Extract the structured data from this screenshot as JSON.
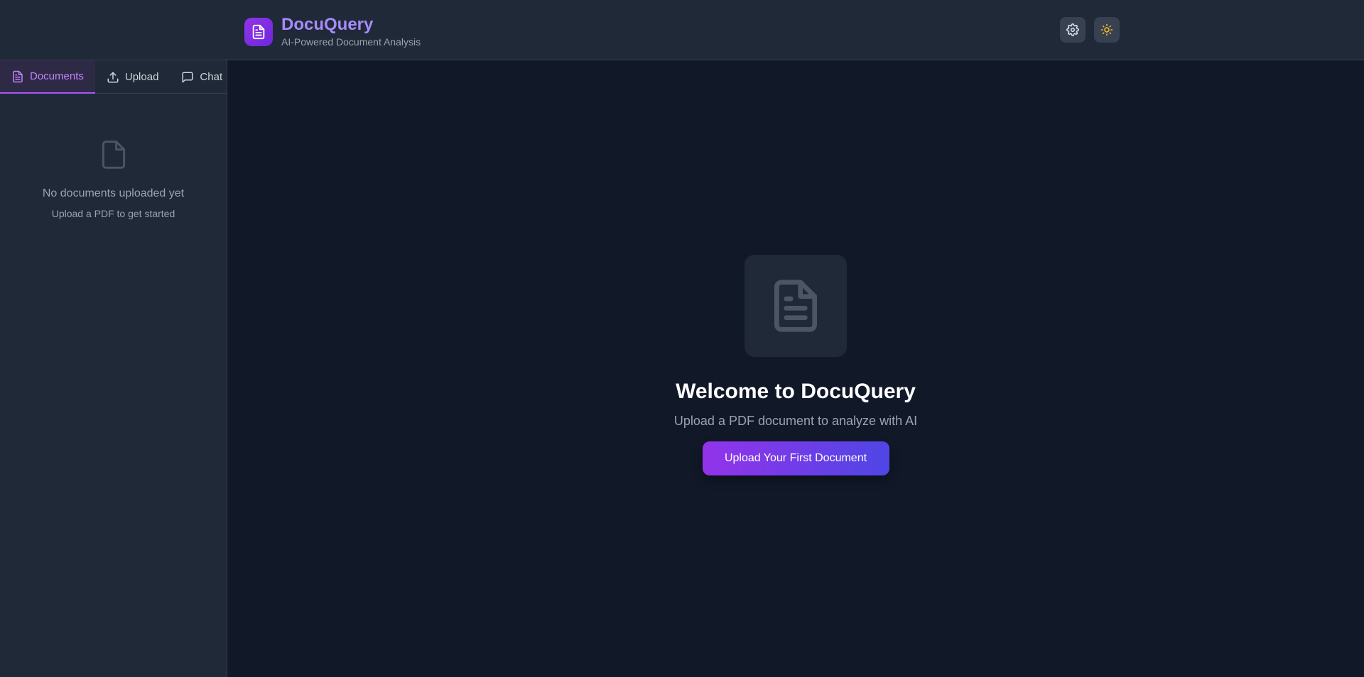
{
  "header": {
    "title": "DocuQuery",
    "subtitle": "AI-Powered Document Analysis",
    "logo_icon": "document-icon",
    "actions": [
      {
        "name": "settings",
        "icon": "gear-icon"
      },
      {
        "name": "theme-toggle",
        "icon": "sun-icon"
      }
    ]
  },
  "sidebar": {
    "tabs": [
      {
        "label": "Documents",
        "icon": "document-icon",
        "active": true
      },
      {
        "label": "Upload",
        "icon": "upload-icon",
        "active": false
      },
      {
        "label": "Chat",
        "icon": "chat-icon",
        "active": false
      }
    ],
    "empty": {
      "icon": "file-icon",
      "title": "No documents uploaded yet",
      "subtitle": "Upload a PDF to get started"
    }
  },
  "main": {
    "welcome": {
      "icon": "document-icon",
      "title": "Welcome to DocuQuery",
      "subtitle": "Upload a PDF document to analyze with AI",
      "cta_label": "Upload Your First Document"
    }
  },
  "colors": {
    "background": "#111827",
    "panel": "#1f2937",
    "accent": "#a855f7",
    "accent_text": "#a78bfa",
    "sun": "#fbbf24"
  }
}
